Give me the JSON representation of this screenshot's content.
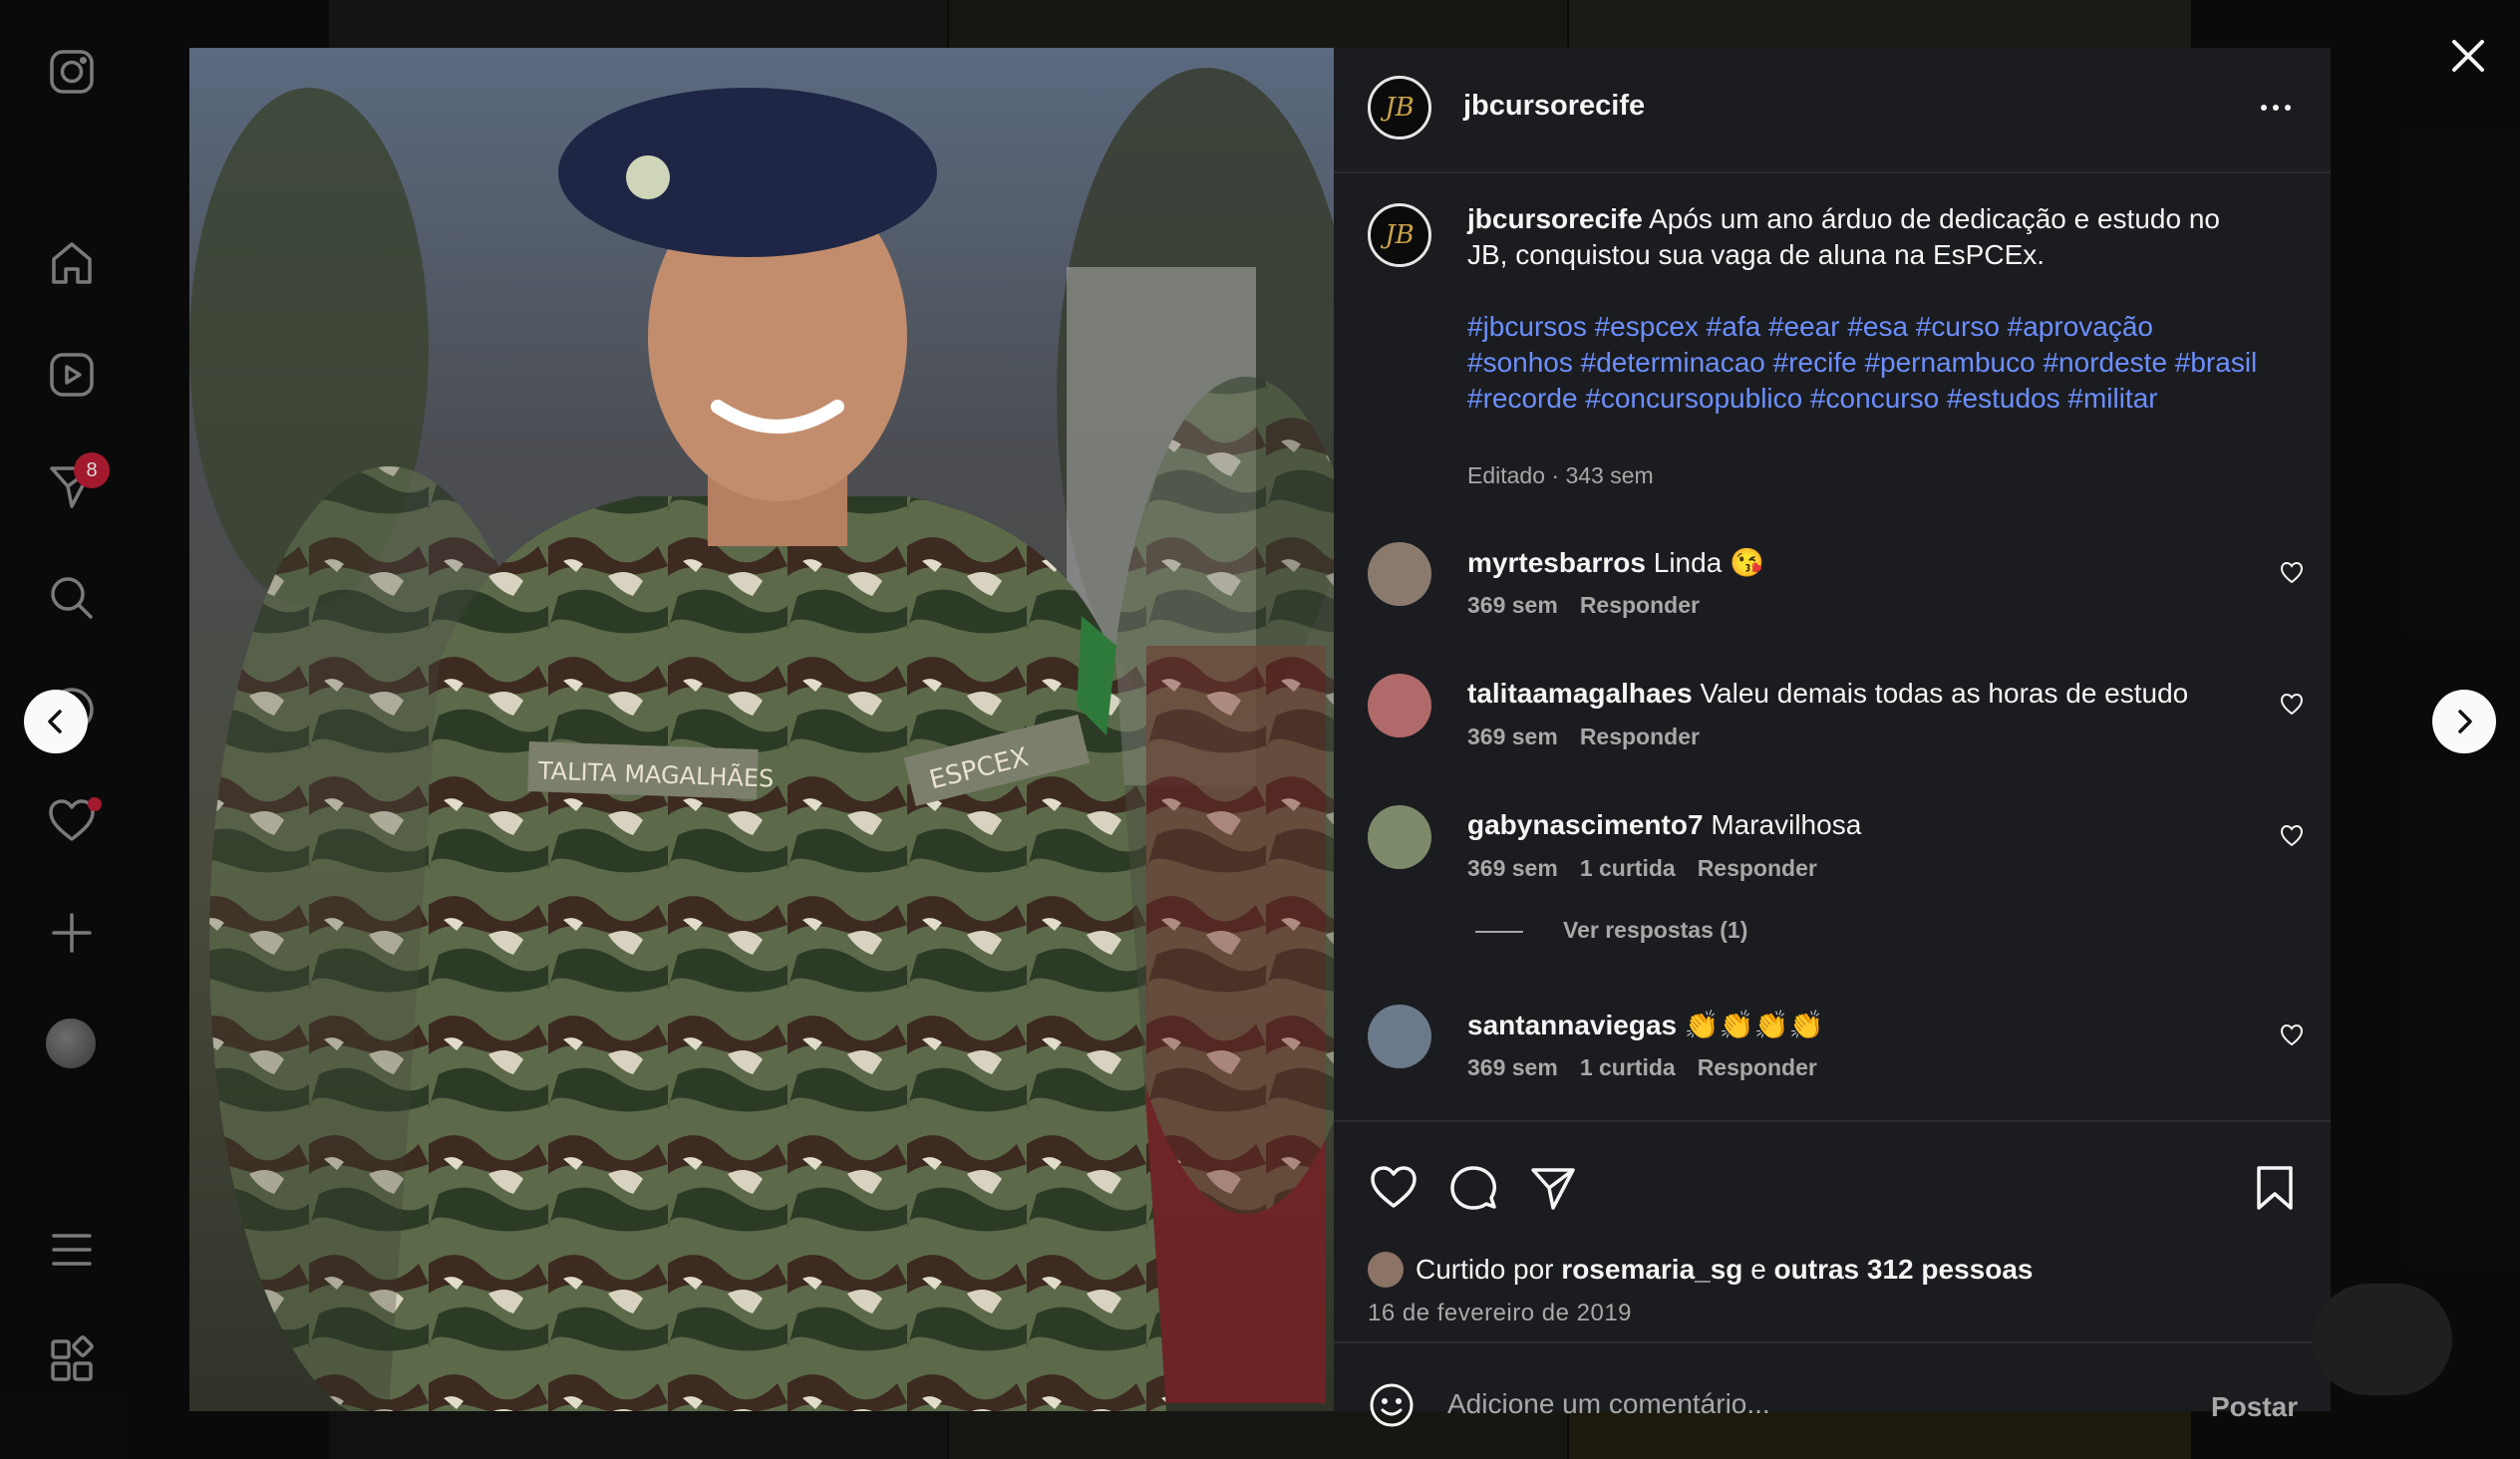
{
  "post": {
    "username": "jbcursorecife",
    "logo_text": "JB",
    "caption_text": "Após um ano árduo de dedicação e estudo no JB, conquistou sua vaga de aluna na EsPCEx.",
    "hashtags": "#jbcursos #espcex #afa #eear #esa #curso #aprovação #sonhos #determinacao #recife #pernambuco #nordeste #brasil #recorde #concursopublico #concurso #estudos #militar",
    "caption_meta": "Editado · 343 sem",
    "photo_labels": {
      "name_tag": "TALITA MAGALHÃES",
      "unit_tag": "ESPCEX"
    }
  },
  "comments": [
    {
      "username": "myrtesbarros",
      "text": "Linda 😘",
      "time": "369 sem",
      "likes": "",
      "reply_label": "Responder",
      "avatar_color": "#8a7a6e"
    },
    {
      "username": "talitaamagalhaes",
      "text": "Valeu demais todas as horas de estudo",
      "time": "369 sem",
      "likes": "",
      "reply_label": "Responder",
      "avatar_color": "#b06a6a"
    },
    {
      "username": "gabynascimento7",
      "text": "Maravilhosa",
      "time": "369 sem",
      "likes": "1 curtida",
      "reply_label": "Responder",
      "avatar_color": "#7d8a6a"
    },
    {
      "username": "santannaviegas",
      "text": "👏👏👏👏",
      "time": "369 sem",
      "likes": "1 curtida",
      "reply_label": "Responder",
      "avatar_color": "#6a7a8a"
    }
  ],
  "view_replies": "Ver respostas (1)",
  "likes": {
    "prefix": "Curtido por",
    "user": "rosemaria_sg",
    "connector": "e",
    "others": "outras 312 pessoas"
  },
  "date": "16 de fevereiro de 2019",
  "composer": {
    "placeholder": "Adicione um comentário...",
    "post_label": "Postar"
  },
  "nav": {
    "notification_count": "8"
  },
  "icons": {
    "rail": [
      "instagram-icon",
      "home-icon",
      "reels-icon",
      "messages-icon",
      "search-icon",
      "explore-icon",
      "heart-icon",
      "create-icon",
      "profile-avatar",
      "menu-icon",
      "more-apps-icon"
    ],
    "actions": [
      "like-icon",
      "comment-icon",
      "share-icon",
      "save-icon"
    ]
  },
  "colors": {
    "hashtag": "#6c8fff",
    "badge": "#a3192e",
    "panel_bg": "#1b1c1f",
    "muted_text": "#a8a8a8"
  }
}
